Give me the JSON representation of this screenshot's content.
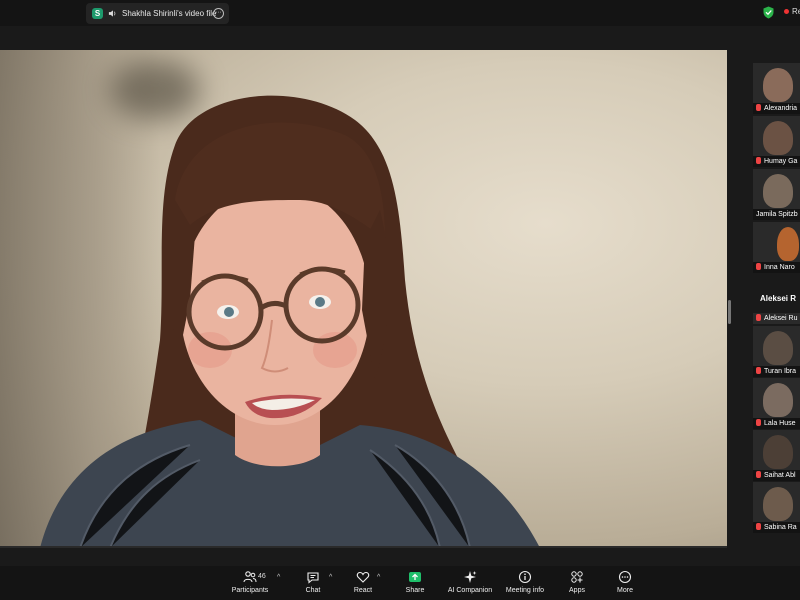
{
  "topbar": {
    "share_badge": "S",
    "share_title": "Shakhla Shirinli's video file",
    "more_label": "⋯",
    "rec_label": "Rec"
  },
  "sidebar": {
    "tiles": [
      {
        "name": "Alexandria",
        "color": "#8a6b5a"
      },
      {
        "name": "Humay Ga",
        "color": "#6b5244"
      },
      {
        "name": "Jamila Spitzb",
        "color": "#7a6a5c"
      },
      {
        "name": "Inna Naro",
        "color": "#b5642f"
      },
      {
        "name": "Aleksei Ru",
        "color": "#2a2a2a"
      },
      {
        "name": "Turan Ibra",
        "color": "#5a4d43"
      },
      {
        "name": "Lala Huse",
        "color": "#7b6b60"
      },
      {
        "name": "Saihat Abl",
        "color": "#4c3f36"
      },
      {
        "name": "Sabina Ra",
        "color": "#6d5b4c"
      }
    ],
    "pinned_header": "Aleksei R"
  },
  "toolbar": {
    "participants_count": "46",
    "items": [
      {
        "label": "Participants",
        "icon": "participants-icon"
      },
      {
        "label": "Chat",
        "icon": "chat-icon"
      },
      {
        "label": "React",
        "icon": "heart-icon"
      },
      {
        "label": "Share",
        "icon": "share-icon"
      },
      {
        "label": "AI Companion",
        "icon": "sparkle-icon"
      },
      {
        "label": "Meeting info",
        "icon": "info-icon"
      },
      {
        "label": "Apps",
        "icon": "apps-icon"
      },
      {
        "label": "More",
        "icon": "more-icon"
      }
    ],
    "caret": "^",
    "share_color": "#1fbf6a"
  }
}
